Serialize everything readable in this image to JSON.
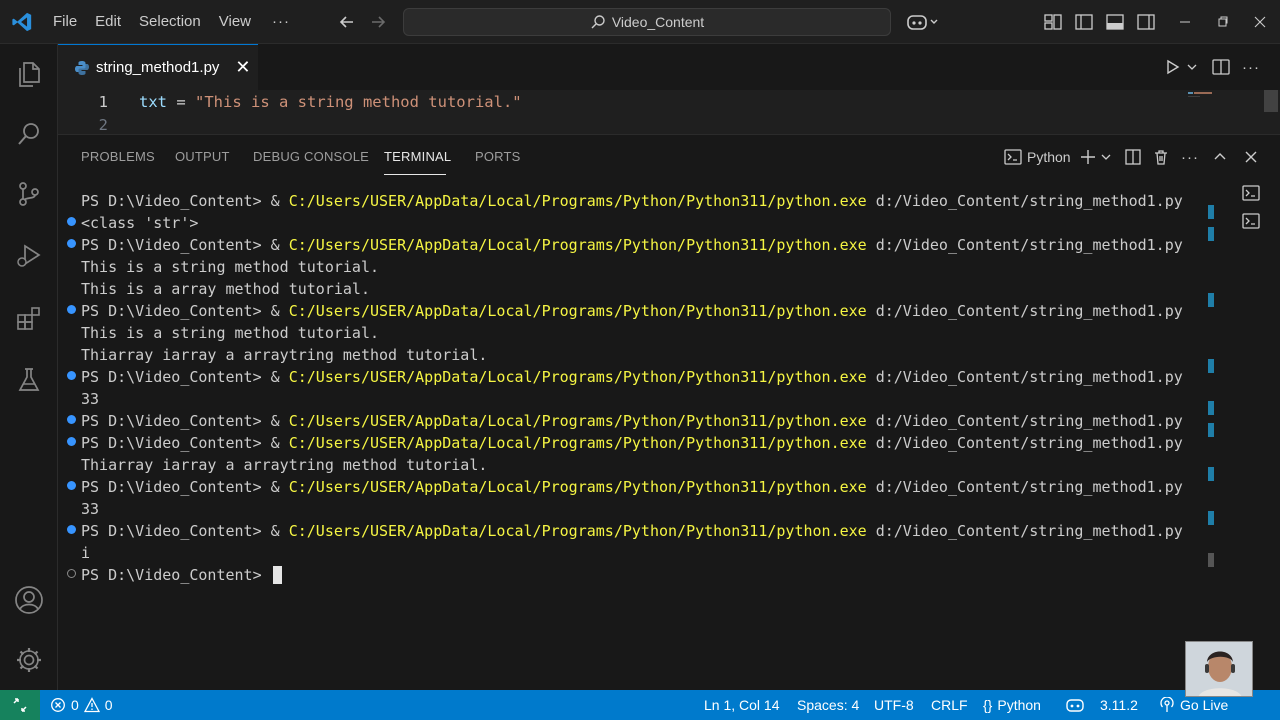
{
  "menu": {
    "file": "File",
    "edit": "Edit",
    "selection": "Selection",
    "view": "View",
    "more": "···"
  },
  "search": {
    "text": "Video_Content"
  },
  "editor": {
    "tab_label": "string_method1.py",
    "lines": [
      {
        "number": "1",
        "var": "txt",
        "op": " = ",
        "str": "\"This is a string method tutorial.\""
      },
      {
        "number": "2"
      }
    ]
  },
  "panel": {
    "tabs": [
      "PROBLEMS",
      "OUTPUT",
      "DEBUG CONSOLE",
      "TERMINAL",
      "PORTS"
    ],
    "active_tab": "TERMINAL",
    "shell_label": "Python"
  },
  "terminal": {
    "prompt": "PS D:\\Video_Content> & ",
    "python_path": "C:/Users/USER/AppData/Local/Programs/Python/Python311/python.exe",
    "script_arg": " d:/Video_Content/string_method1.py",
    "outputs": {
      "o1": "<class 'str'>",
      "o2": "This is a string method tutorial.",
      "o3": "This is a array method tutorial.",
      "o4": "This is a string method tutorial.",
      "o5": "Thiarray iarray a arraytring method tutorial.",
      "o6": "33",
      "o7": "Thiarray iarray a arraytring method tutorial.",
      "o8": "33",
      "o9": "i"
    },
    "final_prompt": "PS D:\\Video_Content> "
  },
  "statusbar": {
    "errors": "0",
    "warnings": "0",
    "position": "Ln 1, Col 14",
    "spaces": "Spaces: 4",
    "encoding": "UTF-8",
    "eol": "CRLF",
    "language": "Python",
    "python_version": "3.11.2",
    "go_live": "Go Live"
  },
  "colors": {
    "accent": "#007acc",
    "remote": "#16825d",
    "path": "#f5f543",
    "string": "#ce9178",
    "variable": "#9cdcfe"
  }
}
